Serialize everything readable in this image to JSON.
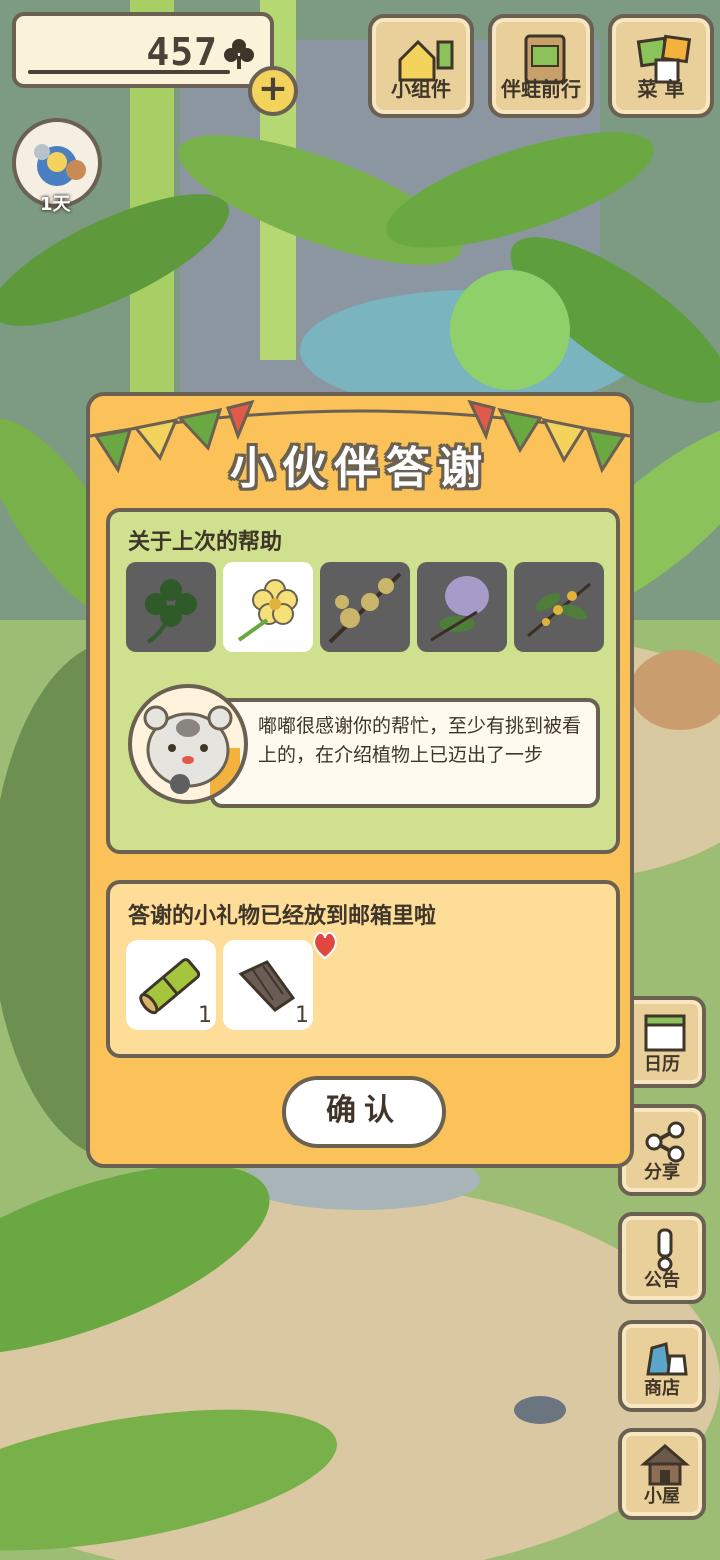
{
  "hud": {
    "clover_count": "457",
    "plus_label": "+",
    "visitor_days": "1天"
  },
  "top_menu": [
    {
      "label": "小组件",
      "icon": "widget-icon"
    },
    {
      "label": "伴蛙前行",
      "icon": "frog-journal-icon"
    },
    {
      "label": "菜 单",
      "icon": "menu-icon"
    }
  ],
  "side_menu": [
    {
      "label": "日历",
      "icon": "calendar-icon"
    },
    {
      "label": "分享",
      "icon": "share-icon"
    },
    {
      "label": "公告",
      "icon": "notice-icon"
    },
    {
      "label": "商店",
      "icon": "shop-icon"
    },
    {
      "label": "小屋",
      "icon": "house-icon"
    }
  ],
  "dialog": {
    "title": "小伙伴答谢",
    "help_section": {
      "heading": "关于上次的帮助",
      "plants": [
        {
          "icon": "four-leaf-clover-icon",
          "selected": false
        },
        {
          "icon": "yellow-flower-icon",
          "selected": true
        },
        {
          "icon": "plum-blossom-branch-icon",
          "selected": false
        },
        {
          "icon": "lilac-branch-icon",
          "selected": false
        },
        {
          "icon": "osmanthus-branch-icon",
          "selected": false
        }
      ],
      "message": "嘟嘟很感谢你的帮忙，至少有挑到被看上的，在介绍植物上已迈出了一步"
    },
    "gift_section": {
      "heading": "答谢的小礼物已经放到邮箱里啦",
      "gifts": [
        {
          "icon": "bamboo-tube-icon",
          "qty": "1"
        },
        {
          "icon": "wood-bark-icon",
          "qty": "1"
        }
      ]
    },
    "confirm_label": "确认"
  },
  "colors": {
    "dialog_bg": "#fcc25a",
    "help_bg": "#cfe08e",
    "gift_bg": "#fedd98",
    "outline": "#6b6152"
  }
}
